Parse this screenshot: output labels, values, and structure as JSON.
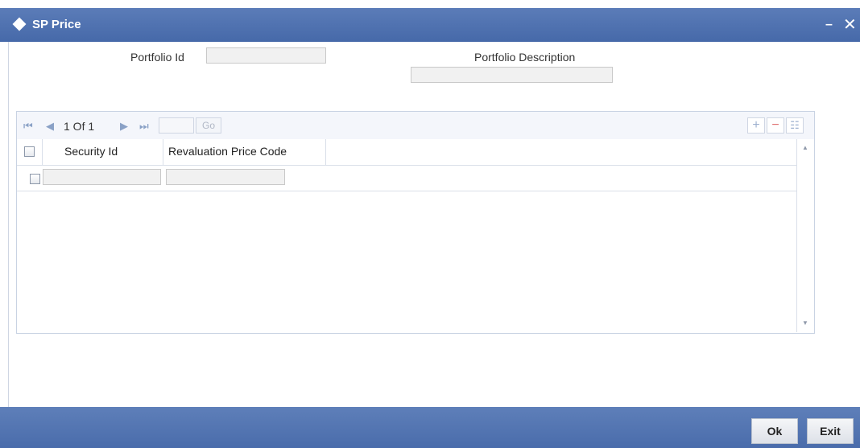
{
  "window": {
    "title": "SP Price",
    "minimize_label": "–",
    "close_label": "✕"
  },
  "form": {
    "portfolio_id": {
      "label": "Portfolio Id",
      "value": ""
    },
    "portfolio_description": {
      "label": "Portfolio Description",
      "value": ""
    }
  },
  "grid": {
    "pager": {
      "first_glyph": "⏮",
      "prev_glyph": "◀",
      "text": "1 Of 1",
      "next_glyph": "▶",
      "last_glyph": "⏭",
      "go_label": "Go",
      "page_value": ""
    },
    "toolbar": {
      "add_glyph": "+",
      "delete_glyph": "−",
      "view_glyph": "☷"
    },
    "columns": [
      "Security Id",
      "Revaluation Price Code"
    ],
    "rows": [
      {
        "security_id": "",
        "revaluation_price_code": ""
      }
    ],
    "scroll_up_glyph": "▲",
    "scroll_down_glyph": "▼"
  },
  "footer": {
    "ok_label": "Ok",
    "exit_label": "Exit"
  },
  "colors": {
    "titlebar": "#4f71ae",
    "footer": "#4f71ae",
    "input_bg": "#f1f1f1"
  }
}
